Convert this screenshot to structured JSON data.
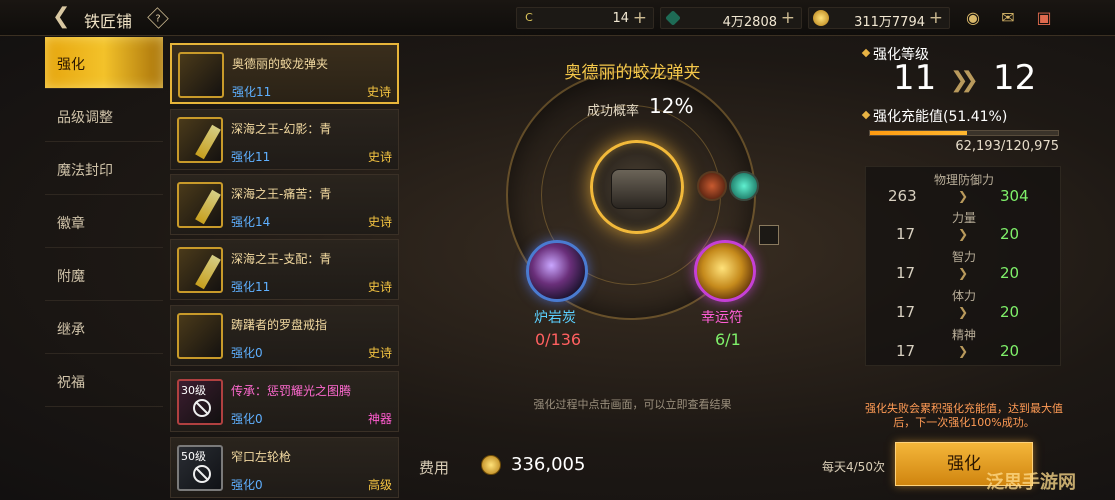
{
  "header": {
    "title": "铁匠铺",
    "help_icon": "?",
    "back_icon": "back-arrow-icon",
    "resources": [
      {
        "icon": "c-coin-icon",
        "value": "14",
        "color": "#d9c35a"
      },
      {
        "icon": "green-crystal-icon",
        "value": "4万2808",
        "color": "#3fd7a8"
      },
      {
        "icon": "gold-coin-icon",
        "value": "311万7794",
        "color": "#e6b337"
      }
    ],
    "icons": [
      "treasure-pot-icon",
      "mail-icon",
      "chat-icon"
    ]
  },
  "menu": {
    "items": [
      {
        "label": "强化",
        "active": true
      },
      {
        "label": "品级调整"
      },
      {
        "label": "魔法封印"
      },
      {
        "label": "徽章"
      },
      {
        "label": "附魔"
      },
      {
        "label": "继承"
      },
      {
        "label": "祝福"
      }
    ]
  },
  "list": {
    "items": [
      {
        "name": "奥德丽的蛟龙弹夹",
        "enh": "强化11",
        "grade": "史诗"
      },
      {
        "name": "深海之王-幻影：青",
        "enh": "强化11",
        "grade": "史诗"
      },
      {
        "name": "深海之王-痛苦：青",
        "enh": "强化14",
        "grade": "史诗"
      },
      {
        "name": "深海之王-支配：青",
        "enh": "强化11",
        "grade": "史诗"
      },
      {
        "name": "踌躇者的罗盘戒指",
        "enh": "强化0",
        "grade": "史诗"
      },
      {
        "name": "传承：惩罚耀光之图腾",
        "enh": "强化0",
        "grade": "神器",
        "level": "30级"
      },
      {
        "name": "窄口左轮枪",
        "enh": "强化0",
        "grade": "高级",
        "level": "50级"
      }
    ]
  },
  "center": {
    "item_name": "奥德丽的蛟龙弹夹",
    "success_label": "成功概率",
    "success_rate": "12%",
    "materials": [
      {
        "name": "炉岩炭",
        "count": "0/136"
      },
      {
        "name": "幸运符",
        "count": "6/1"
      }
    ],
    "hint": "强化过程中点击画面，可以立即查看结果"
  },
  "right": {
    "level_label": "强化等级",
    "level_from": "11",
    "level_to": "12",
    "charge_label": "强化充能值(51.41%)",
    "charge_progress": 0.5141,
    "charge_numbers": "62,193/120,975",
    "stats": [
      {
        "name": "物理防御力",
        "old": "263",
        "new": "304"
      },
      {
        "name": "力量",
        "old": "17",
        "new": "20"
      },
      {
        "name": "智力",
        "old": "17",
        "new": "20"
      },
      {
        "name": "体力",
        "old": "17",
        "new": "20"
      },
      {
        "name": "精神",
        "old": "17",
        "new": "20"
      }
    ],
    "fail_note": "强化失败会累积强化充能值，达到最大值后，下一次强化100%成功。"
  },
  "bottom": {
    "cost_label": "费用",
    "cost_value": "336,005",
    "daily": "每天4/50次",
    "button_label": "强化"
  },
  "watermark": "泛思手游网"
}
